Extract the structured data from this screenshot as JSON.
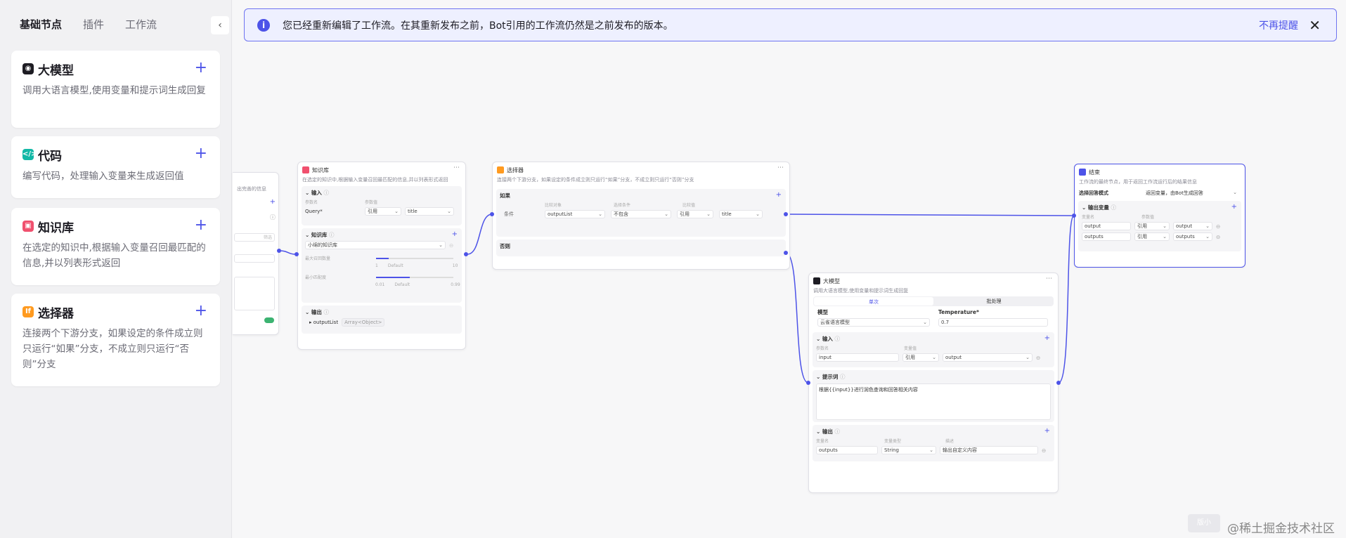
{
  "sidebar": {
    "tabs": [
      {
        "label": "基础节点"
      },
      {
        "label": "插件"
      },
      {
        "label": "工作流"
      }
    ],
    "collapse_icon": "chevron-left-icon",
    "cards": [
      {
        "title": "大模型",
        "desc": "调用大语言模型,使用变量和提示词生成回复",
        "icon": "llm-icon",
        "color": "#1d1c23"
      },
      {
        "title": "代码",
        "desc": "编写代码，处理输入变量来生成返回值",
        "icon": "code-icon",
        "color": "#12b8a6"
      },
      {
        "title": "知识库",
        "desc": "在选定的知识中,根据输入变量召回最匹配的信息,并以列表形式返回",
        "icon": "knowledge-icon",
        "color": "#f0506e"
      },
      {
        "title": "选择器",
        "desc": "连接两个下游分支，如果设定的条件成立则只运行“如果”分支，不成立则只运行“否则”分支",
        "icon": "selector-icon",
        "color": "#ff9a1f"
      }
    ]
  },
  "banner": {
    "text": "您已经重新编辑了工作流。在其重新发布之前，Bot引用的工作流仍然是之前发布的版本。",
    "dismiss": "不再提醒",
    "close": "✕"
  },
  "partial_node": {
    "desc": "出完善的信息",
    "filter": "筛选"
  },
  "knowledge_node": {
    "title": "知识库",
    "desc": "在选定的知识中,根据输入变量召回最匹配的信息,并以列表形式返回",
    "input": "输入",
    "col_name": "参数名",
    "col_value": "参数值",
    "param": "Query*",
    "ref": "引用",
    "val": "title",
    "kb": "知识库",
    "kb_item": "小绵的知识库",
    "topk": "最大召回数量",
    "topk_min": "1",
    "topk_default": "Default",
    "topk_max": "10",
    "score": "最小匹配度",
    "score_min": "0.01",
    "score_default": "Default",
    "score_max": "0.99",
    "output": "输出",
    "out_name": "outputList",
    "out_type": "Array<Object>"
  },
  "selector_node": {
    "title": "选择器",
    "desc": "连接两个下游分支，如果设定的条件成立则只运行“如果”分支，不成立则只运行“否则”分支",
    "if": "如果",
    "cond": "条件",
    "c1": "outputList",
    "c2": "不包含",
    "c3": "引用",
    "c4": "title",
    "else": "否则",
    "h1": "比较对象",
    "h2": "选择条件",
    "h3": "比较值"
  },
  "end_node": {
    "title": "结束",
    "desc": "工作流的最终节点，用于返回工作流运行后的结果信息",
    "mode_label": "选择回答模式",
    "mode": "返回变量，由Bot生成回答",
    "out_var": "输出变量",
    "col1": "变量名",
    "col2": "参数值",
    "rows": [
      {
        "name": "output",
        "ref": "引用",
        "val": "output"
      },
      {
        "name": "outputs",
        "ref": "引用",
        "val": "outputs"
      }
    ]
  },
  "llm_node": {
    "title": "大模型",
    "desc": "调用大语言模型,使用变量和提示词生成回复",
    "tab1": "单次",
    "tab2": "批处理",
    "model_label": "模型",
    "model": "云雀语言模型",
    "temp_label": "Temperature*",
    "temp": "0.7",
    "input": "输入",
    "col1": "参数名",
    "col2": "变量值",
    "in_name": "input",
    "in_ref": "引用",
    "in_val": "output",
    "prompt": "提示词",
    "prompt_text": "根据{{input}}进行润色查询和回答相关内容",
    "output": "输出",
    "o1": "变量名",
    "o2": "变量类型",
    "o3": "描述",
    "out_name": "outputs",
    "out_type": "String",
    "out_desc": "输出自定义内容"
  },
  "watermark": "@稀土掘金技术社区",
  "tag": "版小"
}
